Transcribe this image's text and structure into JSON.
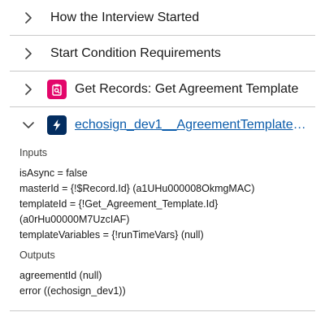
{
  "sections": [
    {
      "title": "How the Interview Started",
      "expanded": false
    },
    {
      "title": "Start Condition Requirements",
      "expanded": false
    },
    {
      "title": "Get Records: Get Agreement Template",
      "expanded": false,
      "icon": "clipboard-search-icon",
      "icon_color": "#e3066a"
    },
    {
      "title": "echosign_dev1__AgreementTemplateLo...",
      "expanded": true,
      "icon": "lightning-bolt-icon",
      "icon_color": "#032d60",
      "link_color": "#0b5cab"
    }
  ],
  "details": {
    "inputs_label": "Inputs",
    "inputs": [
      "isAsync = false",
      "masterId = {!$Record.Id} (a1UHu000008OkmgMAC)",
      "templateId = {!Get_Agreement_Template.Id}",
      "(a0rHu00000M7UzcIAF)",
      "templateVariables = {!runTimeVars} (null)"
    ],
    "outputs_label": "Outputs",
    "outputs": [
      "agreementId (null)",
      "error ((echosign_dev1))"
    ]
  }
}
